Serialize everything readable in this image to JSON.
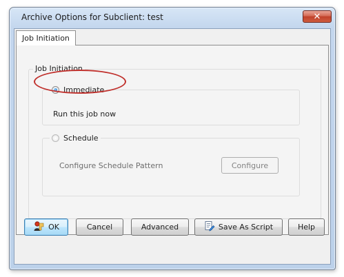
{
  "dialog": {
    "title": "Archive Options for Subclient: test",
    "close_glyph": "✕"
  },
  "tabs": [
    {
      "label": "Job Initiation",
      "selected": true
    }
  ],
  "job_initiation": {
    "group_label": "Job Initiation",
    "immediate": {
      "label": "Immediate",
      "selected": true,
      "description": "Run this job now"
    },
    "schedule": {
      "label": "Schedule",
      "selected": false,
      "configure_text": "Configure Schedule Pattern",
      "configure_button": "Configure"
    }
  },
  "buttons": {
    "ok": {
      "label": "OK",
      "icon": "ok-user-icon"
    },
    "cancel": {
      "label": "Cancel"
    },
    "advanced": {
      "label": "Advanced"
    },
    "save_as_script": {
      "label": "Save As Script",
      "icon": "script-icon"
    },
    "help": {
      "label": "Help"
    }
  },
  "colors": {
    "highlight_oval": "#c0302c",
    "close_button": "#c0412b",
    "default_button_border": "#3c7fb1"
  }
}
